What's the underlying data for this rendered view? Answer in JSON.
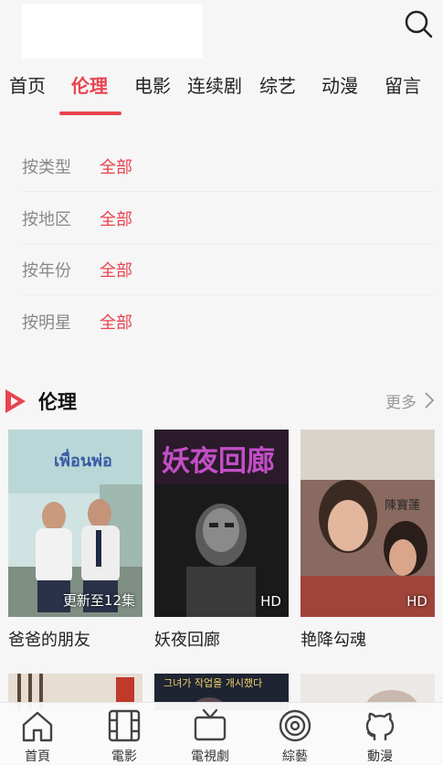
{
  "header": {
    "search_icon": "search-icon"
  },
  "tabs": [
    {
      "label": "首页",
      "active": false
    },
    {
      "label": "伦理",
      "active": true
    },
    {
      "label": "电影",
      "active": false
    },
    {
      "label": "连续剧",
      "active": false
    },
    {
      "label": "综艺",
      "active": false
    },
    {
      "label": "动漫",
      "active": false
    },
    {
      "label": "留言",
      "active": false
    }
  ],
  "filters": [
    {
      "label": "按类型",
      "value": "全部"
    },
    {
      "label": "按地区",
      "value": "全部"
    },
    {
      "label": "按年份",
      "value": "全部"
    },
    {
      "label": "按明星",
      "value": "全部"
    }
  ],
  "section": {
    "title": "伦理",
    "more": "更多"
  },
  "cards": [
    {
      "title": "爸爸的朋友",
      "badge": "更新至12集",
      "poster_text": ""
    },
    {
      "title": "妖夜回廊",
      "badge": "HD",
      "poster_text": "妖夜回廊"
    },
    {
      "title": "艳降勾魂",
      "badge": "HD",
      "poster_text": "陳寶蓮"
    }
  ],
  "row2_text": "그녀가 작업을 개시했다",
  "bottom_nav": [
    {
      "label": "首頁",
      "icon": "home-icon"
    },
    {
      "label": "電影",
      "icon": "film-icon"
    },
    {
      "label": "電視劇",
      "icon": "tv-icon"
    },
    {
      "label": "綜藝",
      "icon": "target-icon"
    },
    {
      "label": "動漫",
      "icon": "github-cat-icon"
    }
  ],
  "colors": {
    "accent": "#e8434f",
    "muted": "#888888",
    "background": "#f6f6f6"
  }
}
